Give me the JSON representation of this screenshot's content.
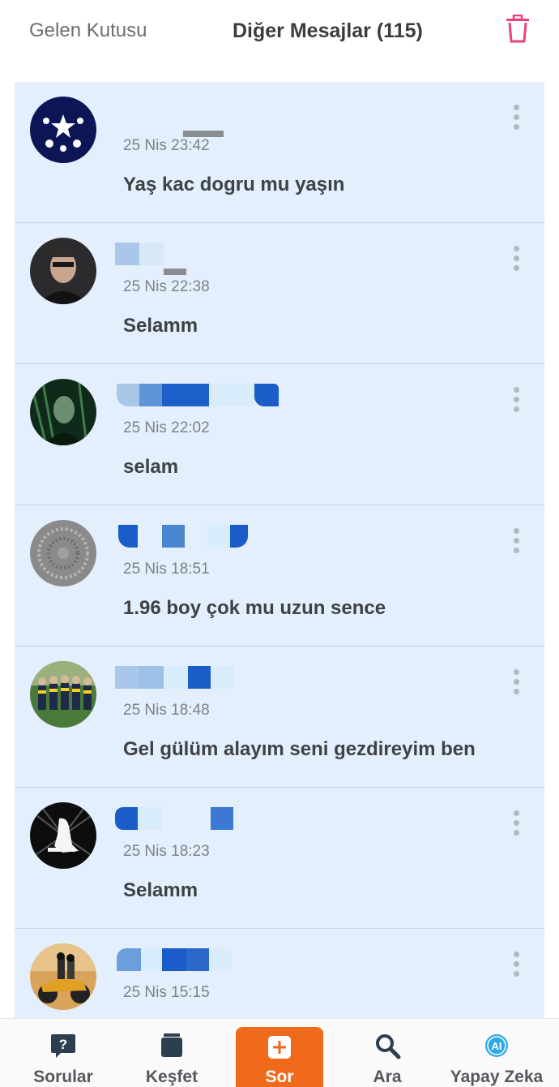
{
  "header": {
    "inbox_label": "Gelen Kutusu",
    "title": "Diğer Mesajlar (115)",
    "trash_icon": "trash-icon",
    "trash_color": "#e8427c"
  },
  "messages": [
    {
      "time": "25 Nis 23:42",
      "text": "Yaş kac dogru mu yaşın",
      "avatar": "champions-league-logo"
    },
    {
      "time": "25 Nis 22:38",
      "text": "Selamm",
      "avatar": "man-in-car-photo"
    },
    {
      "time": "25 Nis 22:02",
      "text": "selam",
      "avatar": "matrix-character-photo"
    },
    {
      "time": "25 Nis 18:51",
      "text": "1.96 boy çok mu uzun sence",
      "avatar": "gray-pattern-photo"
    },
    {
      "time": "25 Nis 18:48",
      "text": "Gel gülüm alayım seni gezdireyim ben",
      "avatar": "football-team-photo"
    },
    {
      "time": "25 Nis 18:23",
      "text": "Selamm",
      "avatar": "silhouette-art-photo"
    },
    {
      "time": "25 Nis 15:15",
      "text": "",
      "avatar": "motorcycle-couple-photo"
    }
  ],
  "nav": {
    "items": [
      {
        "label": "Sorular",
        "icon": "question-bubble-icon"
      },
      {
        "label": "Keşfet",
        "icon": "cards-stack-icon"
      },
      {
        "label": "Sor",
        "icon": "plus-square-icon"
      },
      {
        "label": "Ara",
        "icon": "search-icon"
      },
      {
        "label": "Yapay Zeka",
        "icon": "ai-badge-icon"
      }
    ],
    "active": "Sor",
    "accent": "#f06a1c"
  }
}
